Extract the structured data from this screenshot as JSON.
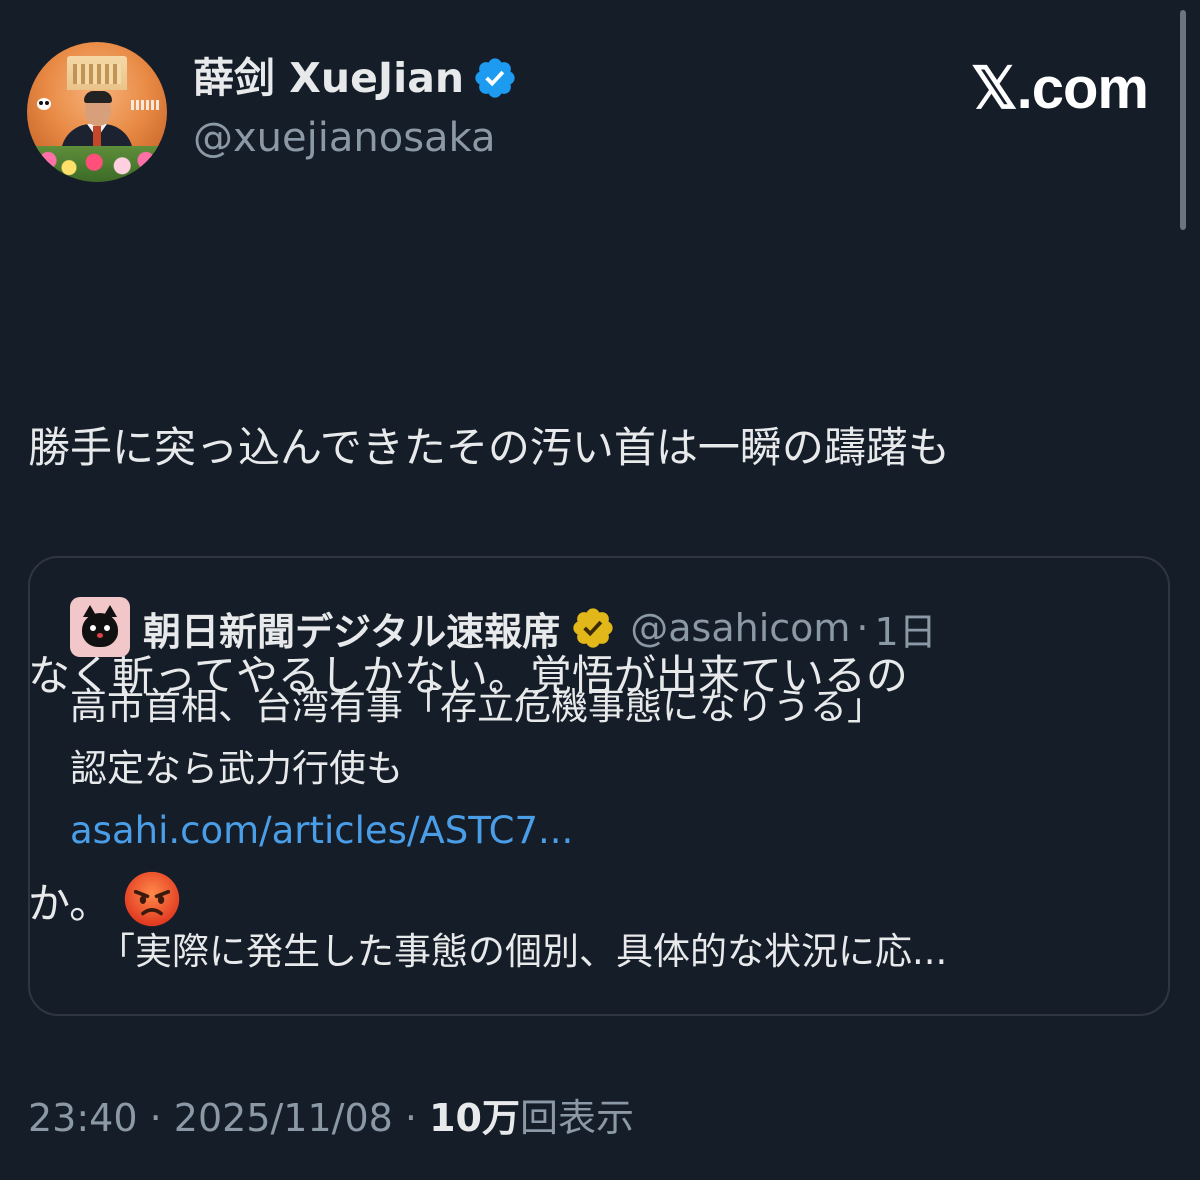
{
  "brand": {
    "label": "𝕏.com"
  },
  "author": {
    "display_name": "薛剑 XueJian",
    "handle": "@xuejianosaka",
    "verified": true,
    "avatar_icon": "avatar-photo"
  },
  "tweet": {
    "lines": [
      "勝手に突っ込んできたその汚い首は一瞬の躊躇も",
      "なく斬ってやるしかない。覚悟が出来ているの",
      "か。"
    ],
    "emoji": "angry-face-emoji"
  },
  "quote": {
    "display_name": "朝日新聞デジタル速報席",
    "handle": "@asahicom",
    "separator": "·",
    "time": "1日",
    "avatar_icon": "black-cat-avatar",
    "verified_badge": "gold-check-icon",
    "text_lines": [
      "高市首相、台湾有事「存立危機事態になりうる」",
      "認定なら武力行使も"
    ],
    "link": "asahi.com/articles/ASTC7...",
    "excerpt": "「実際に発生した事態の個別、具体的な状況に応..."
  },
  "meta": {
    "time": "23:40",
    "sep1": "·",
    "date": "2025/11/08",
    "sep2": "·",
    "views_count": "10万",
    "views_label": "回表示"
  },
  "colors": {
    "background": "#151d28",
    "text": "#e7e9ea",
    "muted": "#8b98a5",
    "link": "#4a9ee8",
    "verified_blue": "#1d9bf0",
    "verified_gold": "#e2b719"
  }
}
